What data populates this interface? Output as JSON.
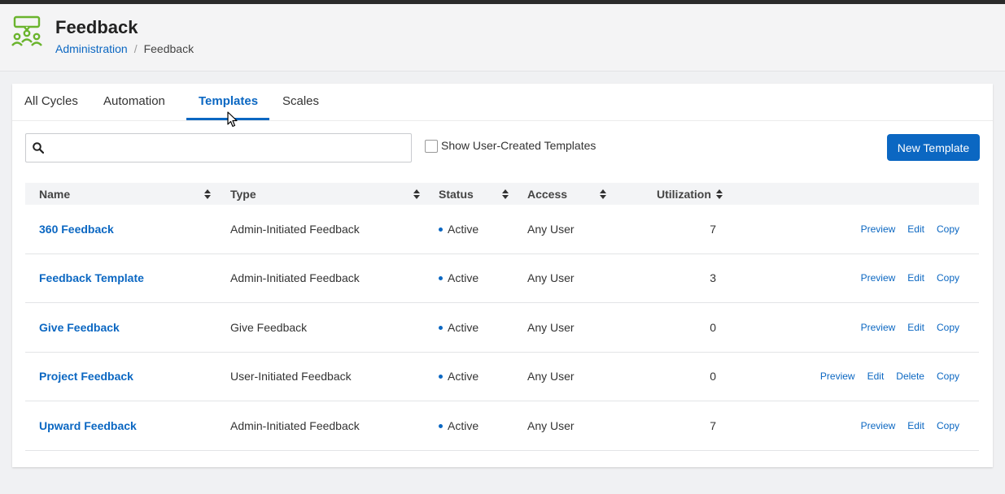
{
  "header": {
    "title": "Feedback",
    "icon": "feedback-people-icon",
    "accent_color": "#6ab42d",
    "breadcrumb": {
      "parent": "Administration",
      "separator": "/",
      "current": "Feedback"
    }
  },
  "tabs": [
    {
      "label": "All Cycles",
      "active": false
    },
    {
      "label": "Automation",
      "active": false
    },
    {
      "label": "Templates",
      "active": true
    },
    {
      "label": "Scales",
      "active": false
    }
  ],
  "toolbar": {
    "search_value": "",
    "search_placeholder": "",
    "show_user_created_label": "Show User-Created Templates",
    "show_user_created_checked": false,
    "new_template_label": "New Template"
  },
  "table": {
    "columns": [
      "Name",
      "Type",
      "Status",
      "Access",
      "Utilization"
    ],
    "rows": [
      {
        "name": "360 Feedback",
        "type": "Admin-Initiated Feedback",
        "status": "Active",
        "access": "Any User",
        "utilization": "7",
        "actions": [
          "Preview",
          "Edit",
          "Copy"
        ]
      },
      {
        "name": "Feedback Template",
        "type": "Admin-Initiated Feedback",
        "status": "Active",
        "access": "Any User",
        "utilization": "3",
        "actions": [
          "Preview",
          "Edit",
          "Copy"
        ]
      },
      {
        "name": "Give Feedback",
        "type": "Give Feedback",
        "status": "Active",
        "access": "Any User",
        "utilization": "0",
        "actions": [
          "Preview",
          "Edit",
          "Copy"
        ]
      },
      {
        "name": "Project Feedback",
        "type": "User-Initiated Feedback",
        "status": "Active",
        "access": "Any User",
        "utilization": "0",
        "actions": [
          "Preview",
          "Edit",
          "Delete",
          "Copy"
        ]
      },
      {
        "name": "Upward Feedback",
        "type": "Admin-Initiated Feedback",
        "status": "Active",
        "access": "Any User",
        "utilization": "7",
        "actions": [
          "Preview",
          "Edit",
          "Copy"
        ]
      }
    ]
  },
  "colors": {
    "primary": "#0b67c2",
    "status_active": "#0b67c2"
  }
}
